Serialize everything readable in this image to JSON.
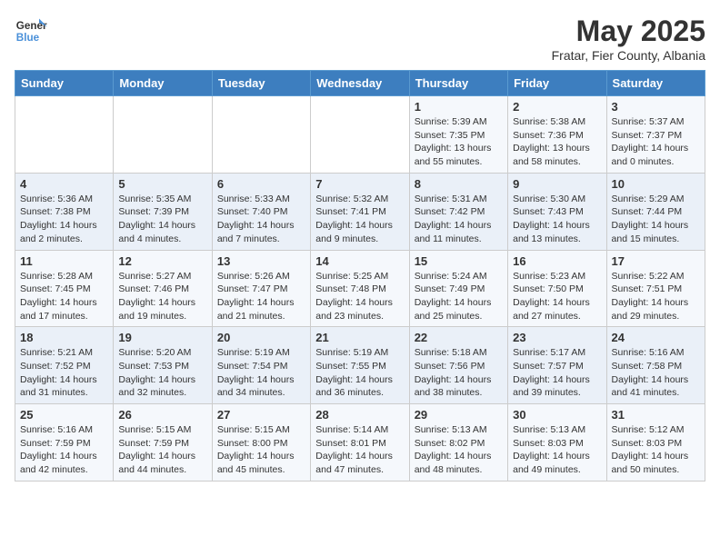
{
  "header": {
    "logo_line1": "General",
    "logo_line2": "Blue",
    "month_title": "May 2025",
    "subtitle": "Fratar, Fier County, Albania"
  },
  "weekdays": [
    "Sunday",
    "Monday",
    "Tuesday",
    "Wednesday",
    "Thursday",
    "Friday",
    "Saturday"
  ],
  "weeks": [
    [
      {
        "day": "",
        "info": ""
      },
      {
        "day": "",
        "info": ""
      },
      {
        "day": "",
        "info": ""
      },
      {
        "day": "",
        "info": ""
      },
      {
        "day": "1",
        "info": "Sunrise: 5:39 AM\nSunset: 7:35 PM\nDaylight: 13 hours\nand 55 minutes."
      },
      {
        "day": "2",
        "info": "Sunrise: 5:38 AM\nSunset: 7:36 PM\nDaylight: 13 hours\nand 58 minutes."
      },
      {
        "day": "3",
        "info": "Sunrise: 5:37 AM\nSunset: 7:37 PM\nDaylight: 14 hours\nand 0 minutes."
      }
    ],
    [
      {
        "day": "4",
        "info": "Sunrise: 5:36 AM\nSunset: 7:38 PM\nDaylight: 14 hours\nand 2 minutes."
      },
      {
        "day": "5",
        "info": "Sunrise: 5:35 AM\nSunset: 7:39 PM\nDaylight: 14 hours\nand 4 minutes."
      },
      {
        "day": "6",
        "info": "Sunrise: 5:33 AM\nSunset: 7:40 PM\nDaylight: 14 hours\nand 7 minutes."
      },
      {
        "day": "7",
        "info": "Sunrise: 5:32 AM\nSunset: 7:41 PM\nDaylight: 14 hours\nand 9 minutes."
      },
      {
        "day": "8",
        "info": "Sunrise: 5:31 AM\nSunset: 7:42 PM\nDaylight: 14 hours\nand 11 minutes."
      },
      {
        "day": "9",
        "info": "Sunrise: 5:30 AM\nSunset: 7:43 PM\nDaylight: 14 hours\nand 13 minutes."
      },
      {
        "day": "10",
        "info": "Sunrise: 5:29 AM\nSunset: 7:44 PM\nDaylight: 14 hours\nand 15 minutes."
      }
    ],
    [
      {
        "day": "11",
        "info": "Sunrise: 5:28 AM\nSunset: 7:45 PM\nDaylight: 14 hours\nand 17 minutes."
      },
      {
        "day": "12",
        "info": "Sunrise: 5:27 AM\nSunset: 7:46 PM\nDaylight: 14 hours\nand 19 minutes."
      },
      {
        "day": "13",
        "info": "Sunrise: 5:26 AM\nSunset: 7:47 PM\nDaylight: 14 hours\nand 21 minutes."
      },
      {
        "day": "14",
        "info": "Sunrise: 5:25 AM\nSunset: 7:48 PM\nDaylight: 14 hours\nand 23 minutes."
      },
      {
        "day": "15",
        "info": "Sunrise: 5:24 AM\nSunset: 7:49 PM\nDaylight: 14 hours\nand 25 minutes."
      },
      {
        "day": "16",
        "info": "Sunrise: 5:23 AM\nSunset: 7:50 PM\nDaylight: 14 hours\nand 27 minutes."
      },
      {
        "day": "17",
        "info": "Sunrise: 5:22 AM\nSunset: 7:51 PM\nDaylight: 14 hours\nand 29 minutes."
      }
    ],
    [
      {
        "day": "18",
        "info": "Sunrise: 5:21 AM\nSunset: 7:52 PM\nDaylight: 14 hours\nand 31 minutes."
      },
      {
        "day": "19",
        "info": "Sunrise: 5:20 AM\nSunset: 7:53 PM\nDaylight: 14 hours\nand 32 minutes."
      },
      {
        "day": "20",
        "info": "Sunrise: 5:19 AM\nSunset: 7:54 PM\nDaylight: 14 hours\nand 34 minutes."
      },
      {
        "day": "21",
        "info": "Sunrise: 5:19 AM\nSunset: 7:55 PM\nDaylight: 14 hours\nand 36 minutes."
      },
      {
        "day": "22",
        "info": "Sunrise: 5:18 AM\nSunset: 7:56 PM\nDaylight: 14 hours\nand 38 minutes."
      },
      {
        "day": "23",
        "info": "Sunrise: 5:17 AM\nSunset: 7:57 PM\nDaylight: 14 hours\nand 39 minutes."
      },
      {
        "day": "24",
        "info": "Sunrise: 5:16 AM\nSunset: 7:58 PM\nDaylight: 14 hours\nand 41 minutes."
      }
    ],
    [
      {
        "day": "25",
        "info": "Sunrise: 5:16 AM\nSunset: 7:59 PM\nDaylight: 14 hours\nand 42 minutes."
      },
      {
        "day": "26",
        "info": "Sunrise: 5:15 AM\nSunset: 7:59 PM\nDaylight: 14 hours\nand 44 minutes."
      },
      {
        "day": "27",
        "info": "Sunrise: 5:15 AM\nSunset: 8:00 PM\nDaylight: 14 hours\nand 45 minutes."
      },
      {
        "day": "28",
        "info": "Sunrise: 5:14 AM\nSunset: 8:01 PM\nDaylight: 14 hours\nand 47 minutes."
      },
      {
        "day": "29",
        "info": "Sunrise: 5:13 AM\nSunset: 8:02 PM\nDaylight: 14 hours\nand 48 minutes."
      },
      {
        "day": "30",
        "info": "Sunrise: 5:13 AM\nSunset: 8:03 PM\nDaylight: 14 hours\nand 49 minutes."
      },
      {
        "day": "31",
        "info": "Sunrise: 5:12 AM\nSunset: 8:03 PM\nDaylight: 14 hours\nand 50 minutes."
      }
    ]
  ]
}
